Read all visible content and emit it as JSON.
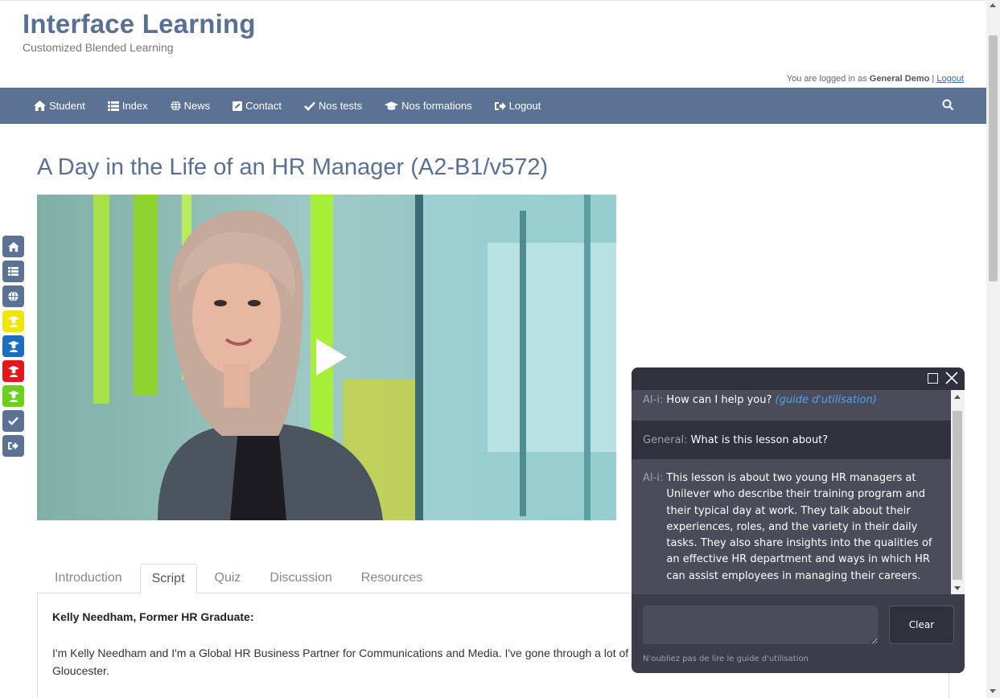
{
  "header": {
    "title": "Interface Learning",
    "subtitle": "Customized Blended Learning",
    "login_prefix": "You are logged in as",
    "user": "General Demo",
    "separator": "|",
    "logout_link": "Logout"
  },
  "nav": {
    "items": [
      {
        "label": "Student",
        "icon": "home-icon"
      },
      {
        "label": "Index",
        "icon": "list-icon"
      },
      {
        "label": "News",
        "icon": "globe-icon"
      },
      {
        "label": "Contact",
        "icon": "edit-icon"
      },
      {
        "label": "Nos tests",
        "icon": "check-icon"
      },
      {
        "label": "Nos formations",
        "icon": "graduation-cap-icon"
      },
      {
        "label": "Logout",
        "icon": "sign-out-icon"
      }
    ],
    "search_icon": "search-icon"
  },
  "page": {
    "title": "A Day in the Life of an HR Manager (A2-B1/v572)"
  },
  "side_tools": [
    {
      "icon": "home-icon",
      "color": "#5b7294"
    },
    {
      "icon": "list-icon",
      "color": "#5b7294"
    },
    {
      "icon": "globe-icon",
      "color": "#5b7294"
    },
    {
      "icon": "user-graduate-icon",
      "color": "#f2e600"
    },
    {
      "icon": "user-graduate-icon",
      "color": "#1a6fc4"
    },
    {
      "icon": "user-graduate-icon",
      "color": "#e3161b"
    },
    {
      "icon": "user-graduate-icon",
      "color": "#6ccf1e"
    },
    {
      "icon": "check-icon",
      "color": "#5b7294"
    },
    {
      "icon": "sign-out-icon",
      "color": "#5b7294"
    }
  ],
  "tabs": {
    "items": [
      "Introduction",
      "Script",
      "Quiz",
      "Discussion",
      "Resources"
    ],
    "active": "Script"
  },
  "script": {
    "speaker": "Kelly Needham, Former HR Graduate:",
    "text": "I'm Kelly Needham and I'm a Global HR Business Partner for Communications and Media. I've gone through a lot of Gloucester."
  },
  "chat": {
    "messages": [
      {
        "who": "AI-i:",
        "text": "How can I help you?",
        "link": "(guide d'utilisation)"
      },
      {
        "who": "General:",
        "text": "What is this lesson about?"
      },
      {
        "who": "AI-i:",
        "text": "This lesson is about two young HR managers at Unilever who describe their training program and their typical day at work. They talk about their experiences, roles, and the variety in their daily tasks. They also share insights into the qualities of an effective HR department and ways in which HR can assist employees in managing their careers."
      }
    ],
    "input_value": "",
    "clear_label": "Clear",
    "note": "N'oubliez pas de lire le guide d'utilisation"
  }
}
